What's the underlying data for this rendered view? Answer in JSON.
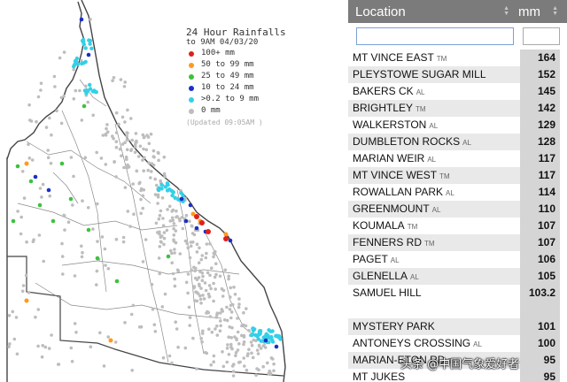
{
  "legend": {
    "title": "24 Hour Rainfalls",
    "subtitle": "to 9AM 04/03/20",
    "items": [
      {
        "label": "100+ mm",
        "color": "#e0201a"
      },
      {
        "label": "50  to 99 mm",
        "color": "#ff9a1a"
      },
      {
        "label": "25  to 49 mm",
        "color": "#3dc23d"
      },
      {
        "label": "10  to 24 mm",
        "color": "#1a2fc8"
      },
      {
        "label": ">0.2 to 9 mm",
        "color": "#33d0e8"
      },
      {
        "label": "0 mm",
        "color": "#bdbdbd"
      }
    ],
    "updated": "(Updated 09:05AM  )"
  },
  "table": {
    "header_location": "Location",
    "header_mm": "mm",
    "location_filter_value": "",
    "mm_filter_value": "",
    "rows": [
      {
        "location": "MT VINCE EAST",
        "suffix": "TM",
        "mm": "164"
      },
      {
        "location": "PLEYSTOWE SUGAR MILL",
        "suffix": "",
        "mm": "152"
      },
      {
        "location": "BAKERS CK",
        "suffix": "AL",
        "mm": "145"
      },
      {
        "location": "BRIGHTLEY",
        "suffix": "TM",
        "mm": "142"
      },
      {
        "location": "WALKERSTON",
        "suffix": "AL",
        "mm": "129"
      },
      {
        "location": "DUMBLETON ROCKS",
        "suffix": "AL",
        "mm": "128"
      },
      {
        "location": "MARIAN WEIR",
        "suffix": "AL",
        "mm": "117"
      },
      {
        "location": "MT VINCE WEST",
        "suffix": "TM",
        "mm": "117"
      },
      {
        "location": "ROWALLAN PARK",
        "suffix": "AL",
        "mm": "114"
      },
      {
        "location": "GREENMOUNT",
        "suffix": "AL",
        "mm": "110"
      },
      {
        "location": "KOUMALA",
        "suffix": "TM",
        "mm": "107"
      },
      {
        "location": "FENNERS RD",
        "suffix": "TM",
        "mm": "107"
      },
      {
        "location": "PAGET",
        "suffix": "AL",
        "mm": "106"
      },
      {
        "location": "GLENELLA",
        "suffix": "AL",
        "mm": "105"
      },
      {
        "location": "SAMUEL HILL",
        "suffix": "",
        "mm": "103.2"
      },
      {
        "location": "MYSTERY PARK",
        "suffix": "",
        "mm": "101"
      },
      {
        "location": "ANTONEYS CROSSING",
        "suffix": "AL",
        "mm": "100"
      },
      {
        "location": "MARIAN-ETON RD",
        "suffix": "TM",
        "mm": "95"
      },
      {
        "location": "MT JUKES",
        "suffix": "",
        "mm": "95"
      }
    ]
  },
  "watermark": "头条 @中国气象爱好者"
}
